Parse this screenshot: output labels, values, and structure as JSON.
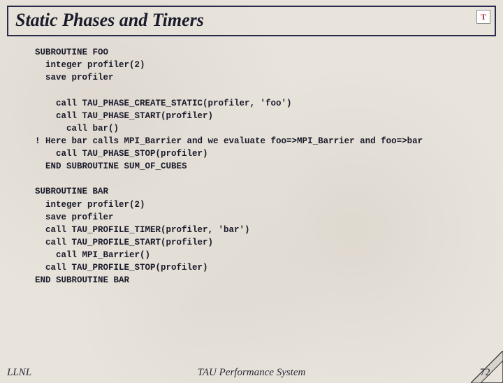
{
  "title": "Static Phases and Timers",
  "logo_letter": "T",
  "code": "SUBROUTINE FOO\n  integer profiler(2)\n  save profiler\n\n    call TAU_PHASE_CREATE_STATIC(profiler, 'foo')\n    call TAU_PHASE_START(profiler)\n      call bar()\n! Here bar calls MPI_Barrier and we evaluate foo=>MPI_Barrier and foo=>bar\n    call TAU_PHASE_STOP(profiler)\n  END SUBROUTINE SUM_OF_CUBES\n\nSUBROUTINE BAR\n  integer profiler(2)\n  save profiler\n  call TAU_PROFILE_TIMER(profiler, 'bar')\n  call TAU_PROFILE_START(profiler)\n    call MPI_Barrier()\n  call TAU_PROFILE_STOP(profiler)\nEND SUBROUTINE BAR",
  "footer": {
    "left": "LLNL",
    "center": "TAU Performance System",
    "right": "72"
  }
}
